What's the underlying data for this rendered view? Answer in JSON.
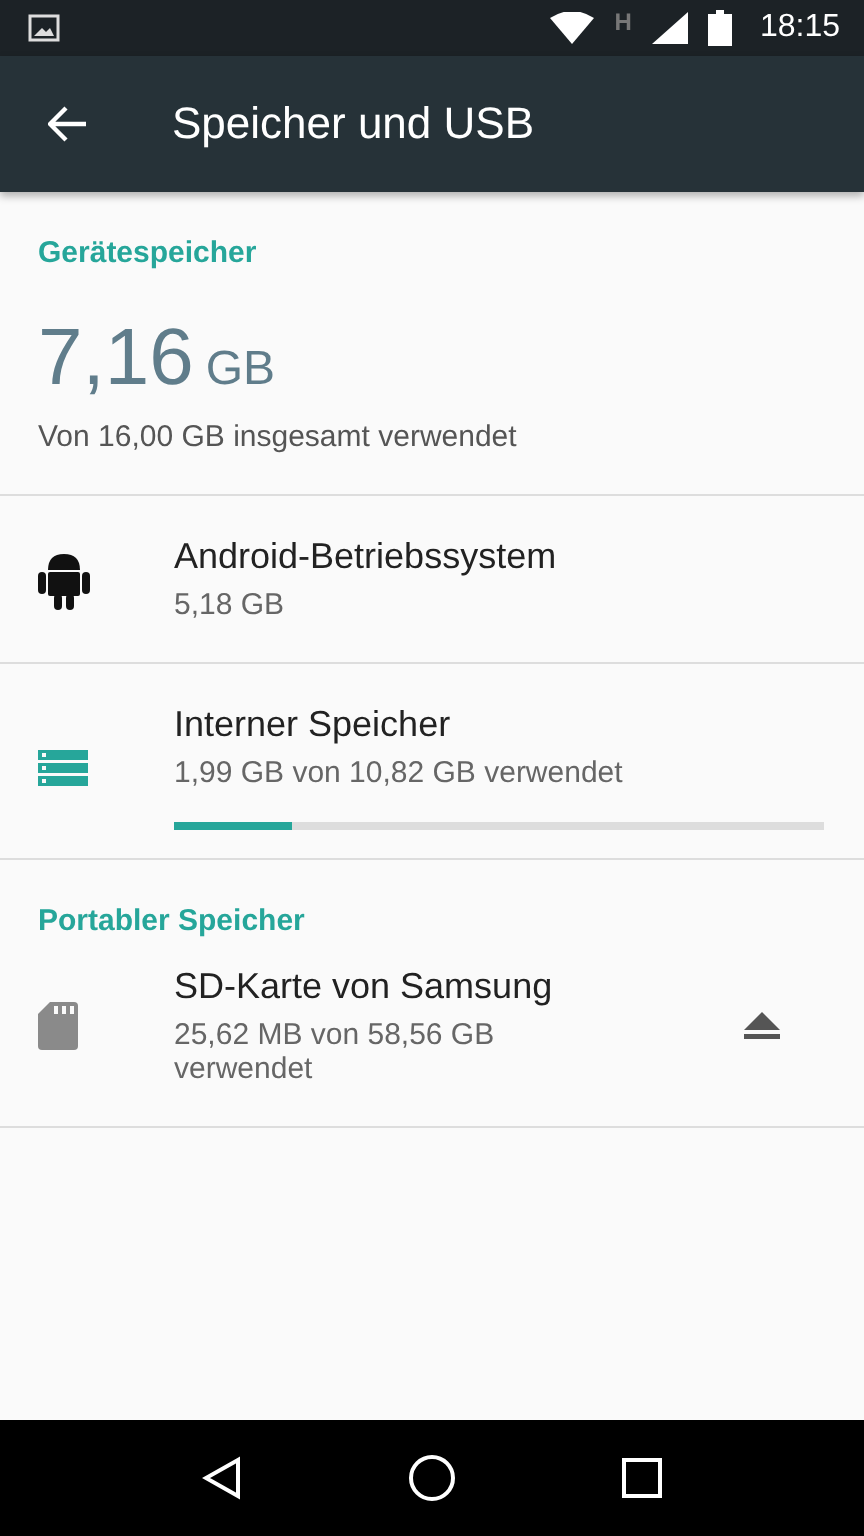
{
  "status_bar": {
    "time": "18:15",
    "network": "H"
  },
  "app_bar": {
    "title": "Speicher und USB"
  },
  "sections": [
    {
      "header": "Gerätespeicher",
      "summary": {
        "value": "7,16",
        "unit": "GB",
        "caption": "Von 16,00 GB insgesamt verwendet"
      },
      "items": [
        {
          "kind": "system",
          "title": "Android-Betriebssystem",
          "subtitle": "5,18 GB"
        },
        {
          "kind": "internal",
          "title": "Interner Speicher",
          "subtitle": "1,99 GB von 10,82 GB verwendet",
          "level": 0.18
        }
      ]
    },
    {
      "header": "Portabler Speicher",
      "items": [
        {
          "kind": "sd",
          "title": "SD-Karte von Samsung",
          "subtitle": "25,62 MB von 58,56 GB verwendet"
        }
      ]
    }
  ]
}
